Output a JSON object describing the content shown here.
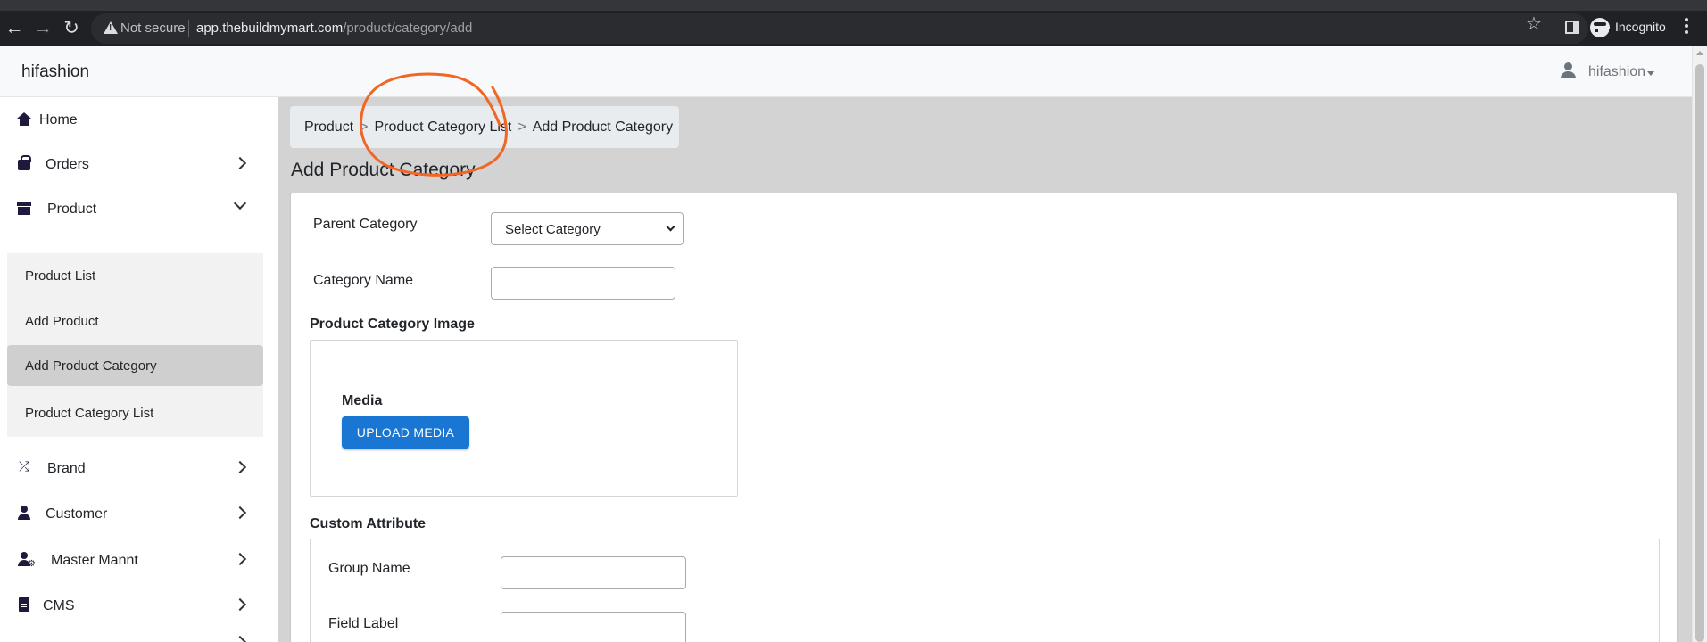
{
  "browser": {
    "security_label": "Not secure",
    "url_host": "app.thebuildmymart.com",
    "url_path": "/product/category/add",
    "profile_label": "Incognito"
  },
  "header": {
    "brand": "hifashion",
    "user_name": "hifashion"
  },
  "sidebar": {
    "items": [
      {
        "label": "Home",
        "icon": "home-icon"
      },
      {
        "label": "Orders",
        "icon": "shopping-bag-icon"
      },
      {
        "label": "Product",
        "icon": "archive-box-icon"
      },
      {
        "label": "Brand",
        "icon": "shuffle-icon"
      },
      {
        "label": "Customer",
        "icon": "user-icon"
      },
      {
        "label": "Master Mannt",
        "icon": "user-gear-icon"
      },
      {
        "label": "CMS",
        "icon": "file-icon"
      }
    ],
    "product_submenu": [
      {
        "label": "Product List"
      },
      {
        "label": "Add Product"
      },
      {
        "label": "Add Product Category",
        "active": true
      },
      {
        "label": "Product Category List"
      }
    ]
  },
  "breadcrumb": {
    "items": [
      "Product",
      "Product Category List",
      "Add Product Category"
    ],
    "separator": ">"
  },
  "page": {
    "title": "Add Product Category"
  },
  "form": {
    "parent_category_label": "Parent Category",
    "parent_category_value": "Select Category",
    "category_name_label": "Category Name",
    "category_name_value": "",
    "image_section_title": "Product Category Image",
    "media_label": "Media",
    "upload_button": "UPLOAD MEDIA",
    "custom_attribute_title": "Custom Attribute",
    "group_name_label": "Group Name",
    "field_label_label": "Field Label"
  },
  "colors": {
    "upload_button": "#1976d2",
    "annotation": "#f26522",
    "sidebar_active": "#cfcfcf",
    "content_bg": "#d3d3d3"
  }
}
